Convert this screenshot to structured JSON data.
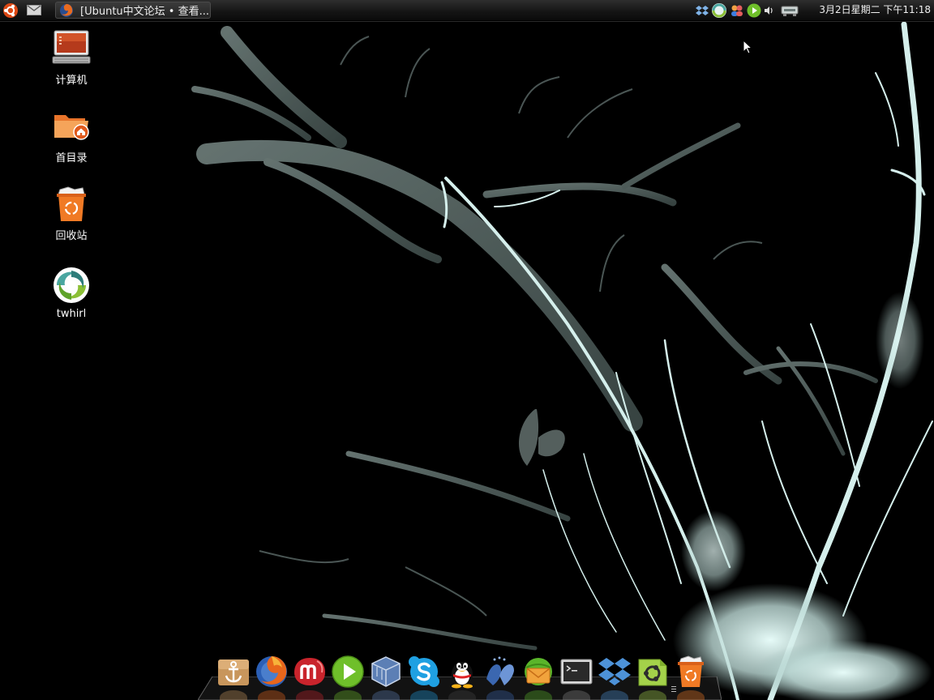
{
  "top_panel": {
    "menu_icon": "ubuntu-logo-icon",
    "mail_icon": "envelope-icon",
    "task_window": {
      "icon": "firefox-icon",
      "title": "[Ubuntu中文论坛 • 查看..."
    },
    "tray_icons": [
      "dropbox-icon",
      "twhirl-icon",
      "messenger-icon",
      "media-player-icon",
      "volume-icon",
      "network-icon"
    ],
    "clock": "3月2日星期二 下午11:18"
  },
  "desktop_icons": [
    {
      "name": "computer",
      "label": "计算机",
      "icon": "computer-icon"
    },
    {
      "name": "home-folder",
      "label": "首目录",
      "icon": "home-folder-icon"
    },
    {
      "name": "trash",
      "label": "回收站",
      "icon": "trash-icon"
    },
    {
      "name": "twhirl",
      "label": "twhirl",
      "icon": "twhirl-icon"
    }
  ],
  "dock": {
    "items": [
      {
        "name": "docky-anchor",
        "icon": "anchor-icon"
      },
      {
        "name": "firefox",
        "icon": "firefox-icon"
      },
      {
        "name": "miro",
        "icon": "miro-icon"
      },
      {
        "name": "media-player",
        "icon": "play-icon"
      },
      {
        "name": "virtualbox",
        "icon": "virtualbox-icon"
      },
      {
        "name": "skype",
        "icon": "skype-icon"
      },
      {
        "name": "qq",
        "icon": "qq-penguin-icon"
      },
      {
        "name": "pidgin",
        "icon": "pidgin-icon"
      },
      {
        "name": "mail-notifier",
        "icon": "envelope-globe-icon"
      },
      {
        "name": "terminal",
        "icon": "terminal-icon"
      },
      {
        "name": "dropbox",
        "icon": "dropbox-icon"
      },
      {
        "name": "ubuntu-one",
        "icon": "ubuntu-tweak-icon"
      },
      {
        "name": "trash",
        "icon": "trash-icon"
      }
    ]
  },
  "colors": {
    "wallpaper_background": "#000000",
    "wallpaper_ink": "#c4ddda",
    "panel": "#1a1a1a",
    "ubuntu_orange": "#dd4814"
  }
}
